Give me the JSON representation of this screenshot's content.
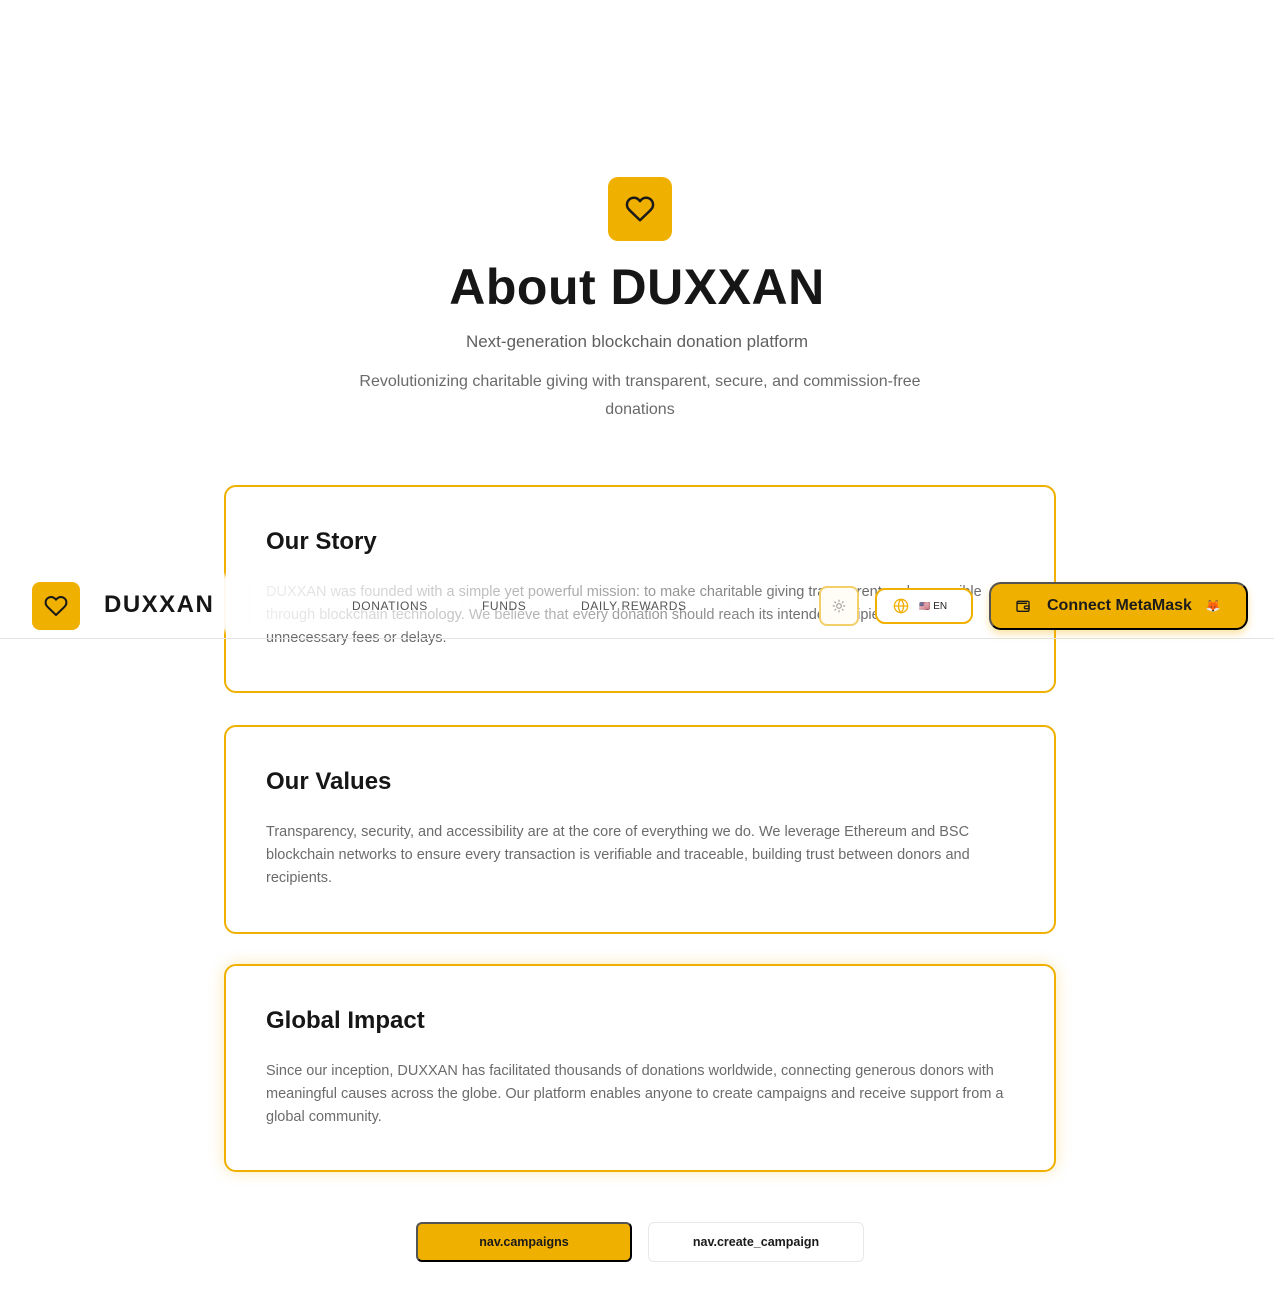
{
  "hero": {
    "icon": "heart-icon",
    "title": "About DUXXAN",
    "subtitle": "Next-generation blockchain donation platform",
    "tagline": "Revolutionizing charitable giving with transparent, secure, and commission-free donations"
  },
  "cards": [
    {
      "title": "Our Story",
      "text": "DUXXAN was founded with a simple yet powerful mission: to make charitable giving transparent and accessible through blockchain technology. We believe that every donation should reach its intended recipient without unnecessary fees or delays."
    },
    {
      "title": "Our Values",
      "text": "Transparency, security, and accessibility are at the core of everything we do. We leverage Ethereum and BSC blockchain networks to ensure every transaction is verifiable and traceable, building trust between donors and recipients."
    },
    {
      "title": "Global Impact",
      "text": "Since our inception, DUXXAN has facilitated thousands of donations worldwide, connecting generous donors with meaningful causes across the globe. Our platform enables anyone to create campaigns and receive support from a global community."
    }
  ],
  "header": {
    "logo_icon": "heart-icon",
    "brand": "DUXXAN",
    "nav": [
      "DONATIONS",
      "FUNDS",
      "DAILY REWARDS"
    ],
    "theme_icon": "sun-icon",
    "language": {
      "icon": "globe-icon",
      "flag": "🇺🇸",
      "code": "EN"
    },
    "connect": {
      "icon": "wallet-icon",
      "label": "Connect MetaMask",
      "badge": "🦊"
    }
  },
  "actions": {
    "primary": "nav.campaigns",
    "secondary": "nav.create_campaign"
  },
  "colors": {
    "accent": "#f0b000",
    "text": "#161616",
    "muted": "#6b6b6b"
  }
}
